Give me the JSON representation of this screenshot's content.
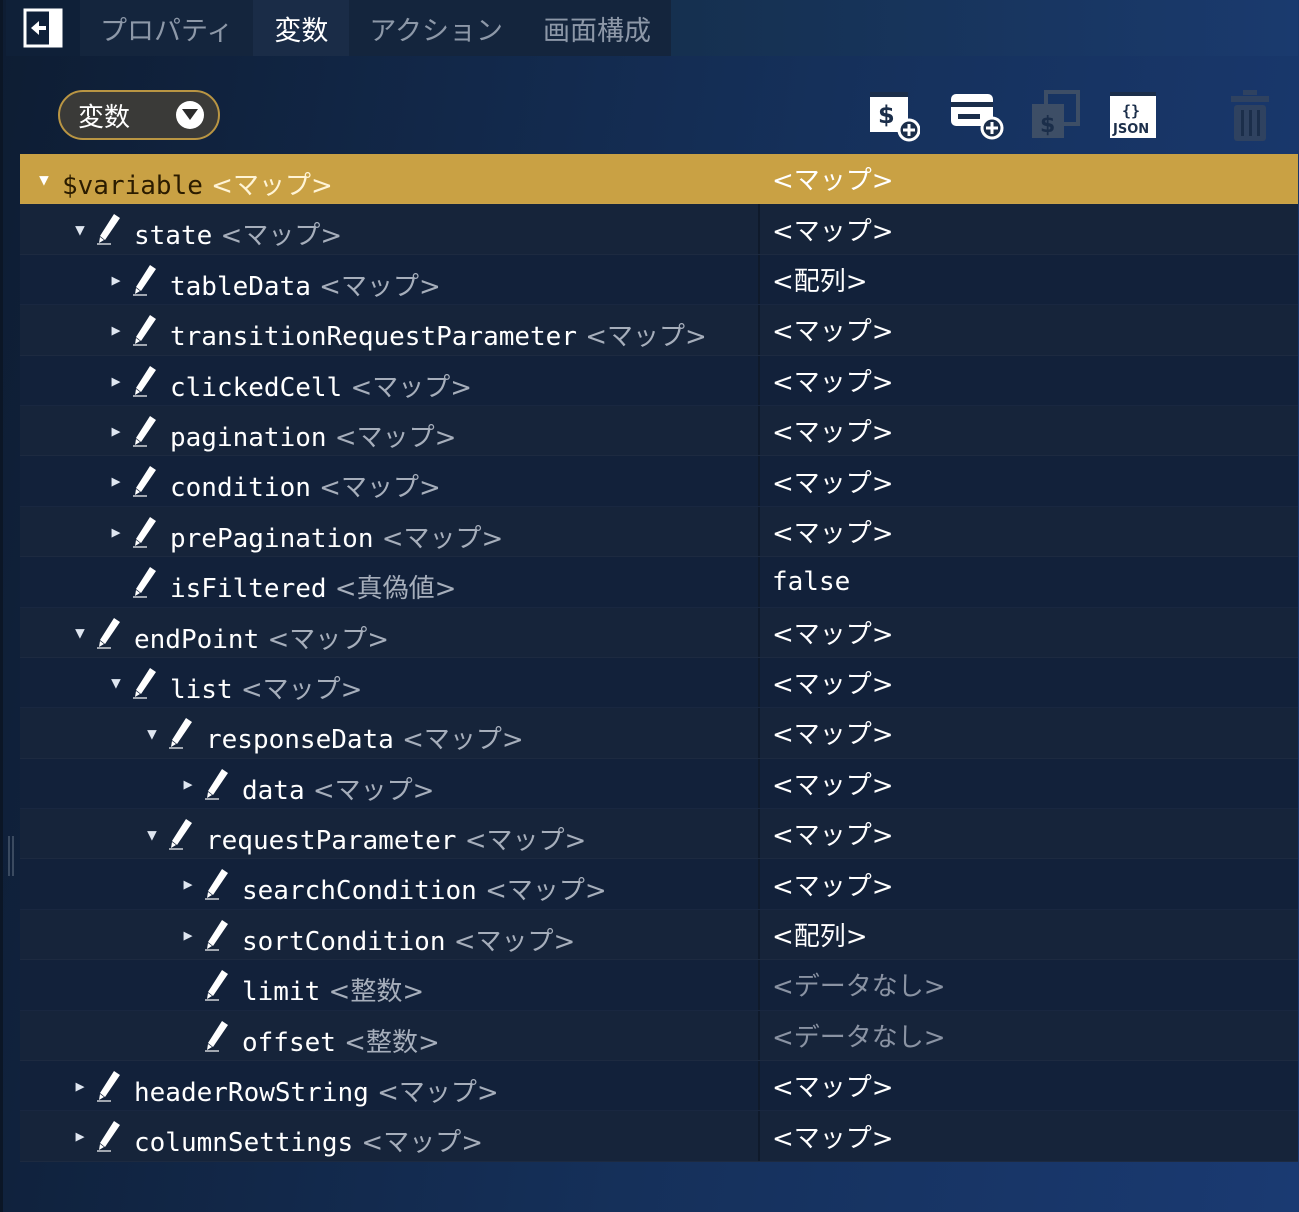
{
  "tabs": [
    {
      "label": "プロパティ",
      "active": false
    },
    {
      "label": "変数",
      "active": true
    },
    {
      "label": "アクション",
      "active": false
    },
    {
      "label": "画面構成",
      "active": false
    }
  ],
  "toolbar": {
    "scope_value": "変数",
    "buttons": [
      {
        "name": "add-variable-button",
        "icon": "dollar-plus-icon"
      },
      {
        "name": "add-map-button",
        "icon": "card-plus-icon"
      },
      {
        "name": "copy-variable-button",
        "icon": "copy-dollar-icon"
      },
      {
        "name": "json-button",
        "icon": "json-icon",
        "text": "JSON"
      },
      {
        "name": "delete-button",
        "icon": "trash-icon"
      }
    ]
  },
  "tree": {
    "rows": [
      {
        "depth": 0,
        "toggle": "down",
        "pencil": false,
        "name": "$variable",
        "type": "<マップ>",
        "value": "<マップ>",
        "muted": false
      },
      {
        "depth": 1,
        "toggle": "down",
        "pencil": true,
        "name": "state",
        "type": "<マップ>",
        "value": "<マップ>",
        "muted": false
      },
      {
        "depth": 2,
        "toggle": "right",
        "pencil": true,
        "name": "tableData",
        "type": "<マップ>",
        "value": "<配列>",
        "muted": false
      },
      {
        "depth": 2,
        "toggle": "right",
        "pencil": true,
        "name": "transitionRequestParameter",
        "type": "<マップ>",
        "value": "<マップ>",
        "muted": false
      },
      {
        "depth": 2,
        "toggle": "right",
        "pencil": true,
        "name": "clickedCell",
        "type": "<マップ>",
        "value": "<マップ>",
        "muted": false
      },
      {
        "depth": 2,
        "toggle": "right",
        "pencil": true,
        "name": "pagination",
        "type": "<マップ>",
        "value": "<マップ>",
        "muted": false
      },
      {
        "depth": 2,
        "toggle": "right",
        "pencil": true,
        "name": "condition",
        "type": "<マップ>",
        "value": "<マップ>",
        "muted": false
      },
      {
        "depth": 2,
        "toggle": "right",
        "pencil": true,
        "name": "prePagination",
        "type": "<マップ>",
        "value": "<マップ>",
        "muted": false
      },
      {
        "depth": 2,
        "toggle": "none",
        "pencil": true,
        "name": "isFiltered",
        "type": "<真偽値>",
        "value": "false",
        "muted": false
      },
      {
        "depth": 1,
        "toggle": "down",
        "pencil": true,
        "name": "endPoint",
        "type": "<マップ>",
        "value": "<マップ>",
        "muted": false
      },
      {
        "depth": 2,
        "toggle": "down",
        "pencil": true,
        "name": "list",
        "type": "<マップ>",
        "value": "<マップ>",
        "muted": false
      },
      {
        "depth": 3,
        "toggle": "down",
        "pencil": true,
        "name": "responseData",
        "type": "<マップ>",
        "value": "<マップ>",
        "muted": false
      },
      {
        "depth": 4,
        "toggle": "right",
        "pencil": true,
        "name": "data",
        "type": "<マップ>",
        "value": "<マップ>",
        "muted": false
      },
      {
        "depth": 3,
        "toggle": "down",
        "pencil": true,
        "name": "requestParameter",
        "type": "<マップ>",
        "value": "<マップ>",
        "muted": false
      },
      {
        "depth": 4,
        "toggle": "right",
        "pencil": true,
        "name": "searchCondition",
        "type": "<マップ>",
        "value": "<マップ>",
        "muted": false
      },
      {
        "depth": 4,
        "toggle": "right",
        "pencil": true,
        "name": "sortCondition",
        "type": "<マップ>",
        "value": "<配列>",
        "muted": false
      },
      {
        "depth": 4,
        "toggle": "none",
        "pencil": true,
        "name": "limit",
        "type": "<整数>",
        "value": "<データなし>",
        "muted": true
      },
      {
        "depth": 4,
        "toggle": "none",
        "pencil": true,
        "name": "offset",
        "type": "<整数>",
        "value": "<データなし>",
        "muted": true
      },
      {
        "depth": 1,
        "toggle": "right",
        "pencil": true,
        "name": "headerRowString",
        "type": "<マップ>",
        "value": "<マップ>",
        "muted": false
      },
      {
        "depth": 1,
        "toggle": "right",
        "pencil": true,
        "name": "columnSettings",
        "type": "<マップ>",
        "value": "<マップ>",
        "muted": false
      }
    ]
  },
  "colors": {
    "selected_row": "#c9a144",
    "panel_bg": "#122847",
    "accent_border": "#b99543"
  }
}
